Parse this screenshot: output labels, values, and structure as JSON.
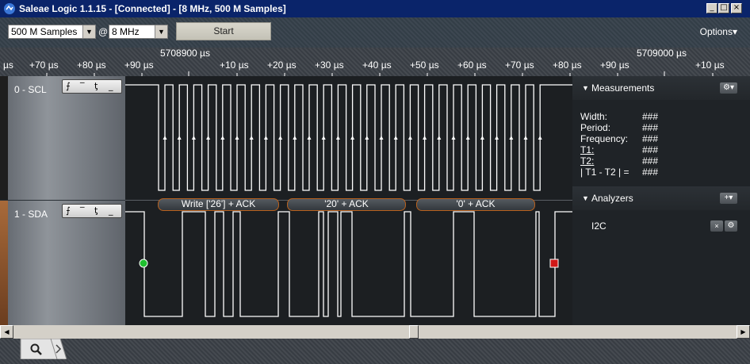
{
  "window": {
    "title": "Saleae Logic 1.1.15 - [Connected] - [8 MHz, 500 M Samples]",
    "minimize": "_",
    "maximize": "□",
    "close": "×"
  },
  "toolbar": {
    "samples_value": "500 M Samples",
    "at": "@",
    "rate_value": "8 MHz",
    "start_label": "Start",
    "options_label": "Options▾"
  },
  "ruler": {
    "abs_left": "5708900 µs",
    "abs_right": "5709000 µs",
    "ticks": [
      "µs",
      "+70 µs",
      "+80 µs",
      "+90 µs",
      "+10 µs",
      "+20 µs",
      "+30 µs",
      "+40 µs",
      "+50 µs",
      "+60 µs",
      "+70 µs",
      "+80 µs",
      "+90 µs",
      "+10 µs"
    ]
  },
  "channels": [
    {
      "name": "0 - SCL",
      "stripe": "#2b2b2b"
    },
    {
      "name": "1 - SDA",
      "stripe": "#7a4a2a"
    }
  ],
  "trigger_icons": {
    "rise": "⨍",
    "high": "‾",
    "fall": "ƫ",
    "low": "_"
  },
  "decoded": [
    "Write ['26'] + ACK",
    "'20' + ACK",
    "'0' + ACK"
  ],
  "measurements": {
    "header": "Measurements",
    "rows": [
      {
        "label": "Width:",
        "value": "###"
      },
      {
        "label": "Period:",
        "value": "###"
      },
      {
        "label": "Frequency:",
        "value": "###"
      },
      {
        "label": "T1:",
        "value": "###"
      },
      {
        "label": "T2:",
        "value": "###"
      },
      {
        "label": "| T1 - T2 | =",
        "value": "###"
      }
    ]
  },
  "analyzers": {
    "header": "Analyzers",
    "items": [
      {
        "name": "I2C"
      }
    ]
  },
  "colors": {
    "accent": "#0a246a",
    "start_marker": "#1fbf2f",
    "stop_marker": "#d01818"
  },
  "icons": {
    "search": "search-icon",
    "next": "chevron-right-icon",
    "gear": "gear-icon"
  }
}
